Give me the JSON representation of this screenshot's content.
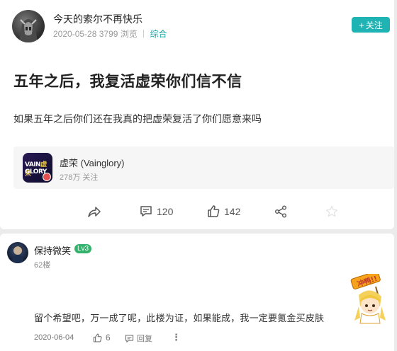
{
  "post": {
    "author": "今天的索尔不再快乐",
    "date": "2020-05-28",
    "views": "3799 浏览",
    "category": "综合",
    "follow_label": "关注",
    "title": "五年之后，我复活虚荣你们信不信",
    "body": "如果五年之后你们还在我真的把虚荣复活了你们愿意来吗",
    "game": {
      "name": "虚荣 (Vainglory)",
      "followers": "278万 关注",
      "logo_line1_a": "VAIN",
      "logo_line1_b": "虚荣",
      "logo_line2": "GLORY"
    },
    "actions": {
      "comments": "120",
      "likes": "142"
    }
  },
  "reply": {
    "author": "保持微笑",
    "level": "Lv3",
    "floor": "62楼",
    "text": "留个希望吧，万一成了呢，此楼为证，如果能成，我一定要氪金买皮肤",
    "date": "2020-06-04",
    "likes": "6",
    "reply_label": "回复",
    "sticker_text": "冲鸭!!"
  },
  "colors": {
    "accent": "#20b3b3",
    "category": "#1aa6a6",
    "level_badge": "#32b26b"
  }
}
